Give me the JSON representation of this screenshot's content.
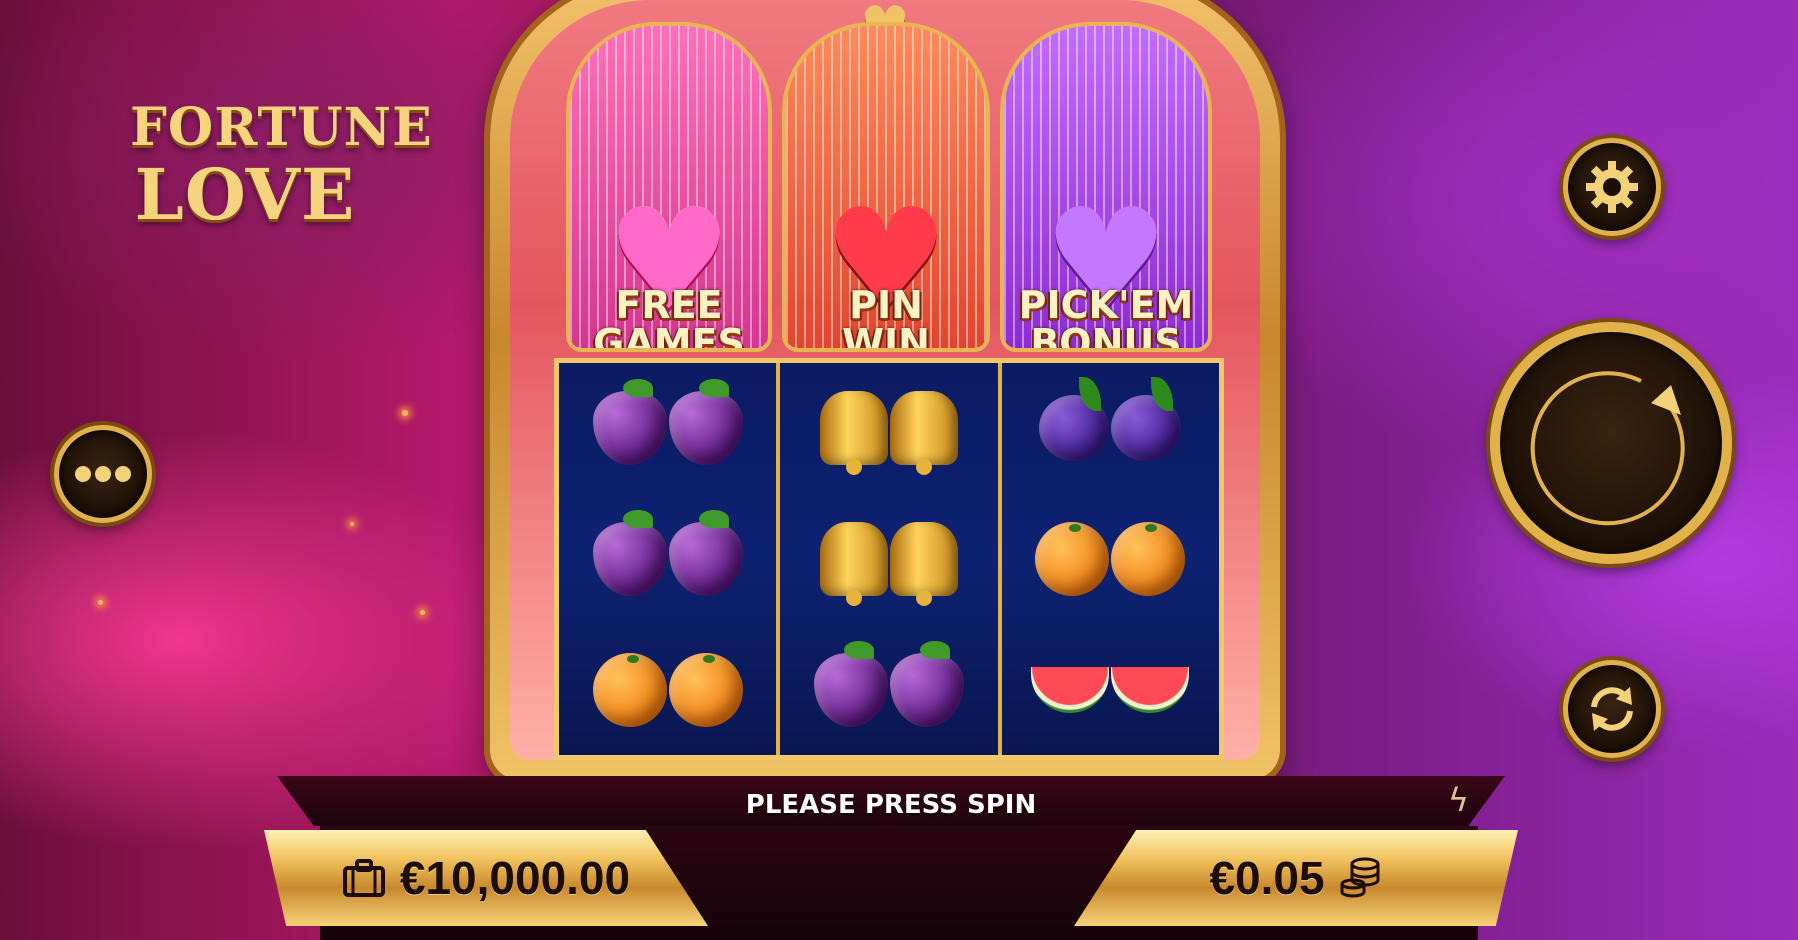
{
  "game": {
    "logo_line1": "FORTUNE",
    "logo_line2": "LOVE",
    "heart_glyph": "♥"
  },
  "bonus_panels": [
    {
      "label_top": "FREE",
      "label_bottom": "GAMES",
      "gem_color": "#ff6ac8"
    },
    {
      "label_top": "PIN",
      "label_bottom": "WIN",
      "gem_color": "#ff3a4a"
    },
    {
      "label_top": "PICK'EM",
      "label_bottom": "BONUS",
      "gem_color": "#c477ff"
    }
  ],
  "reels": [
    [
      "grapes",
      "grapes",
      "oranges"
    ],
    [
      "bells",
      "bells",
      "grapes"
    ],
    [
      "plums",
      "oranges",
      "watermelons"
    ]
  ],
  "status": {
    "message": "PLEASE PRESS SPIN",
    "turbo_icon": "lightning-icon"
  },
  "balance": {
    "value": "€10,000.00",
    "icon": "briefcase-icon"
  },
  "bet": {
    "value": "€0.05",
    "icon": "coin-stack-icon"
  },
  "controls": {
    "menu_icon": "more-dots-icon",
    "settings_icon": "gear-icon",
    "spin_icon": "spin-arrow-icon",
    "autoplay_icon": "autoplay-icon"
  },
  "colors": {
    "gold": "#e2b24a",
    "reel_bg": "#0b1a59"
  }
}
